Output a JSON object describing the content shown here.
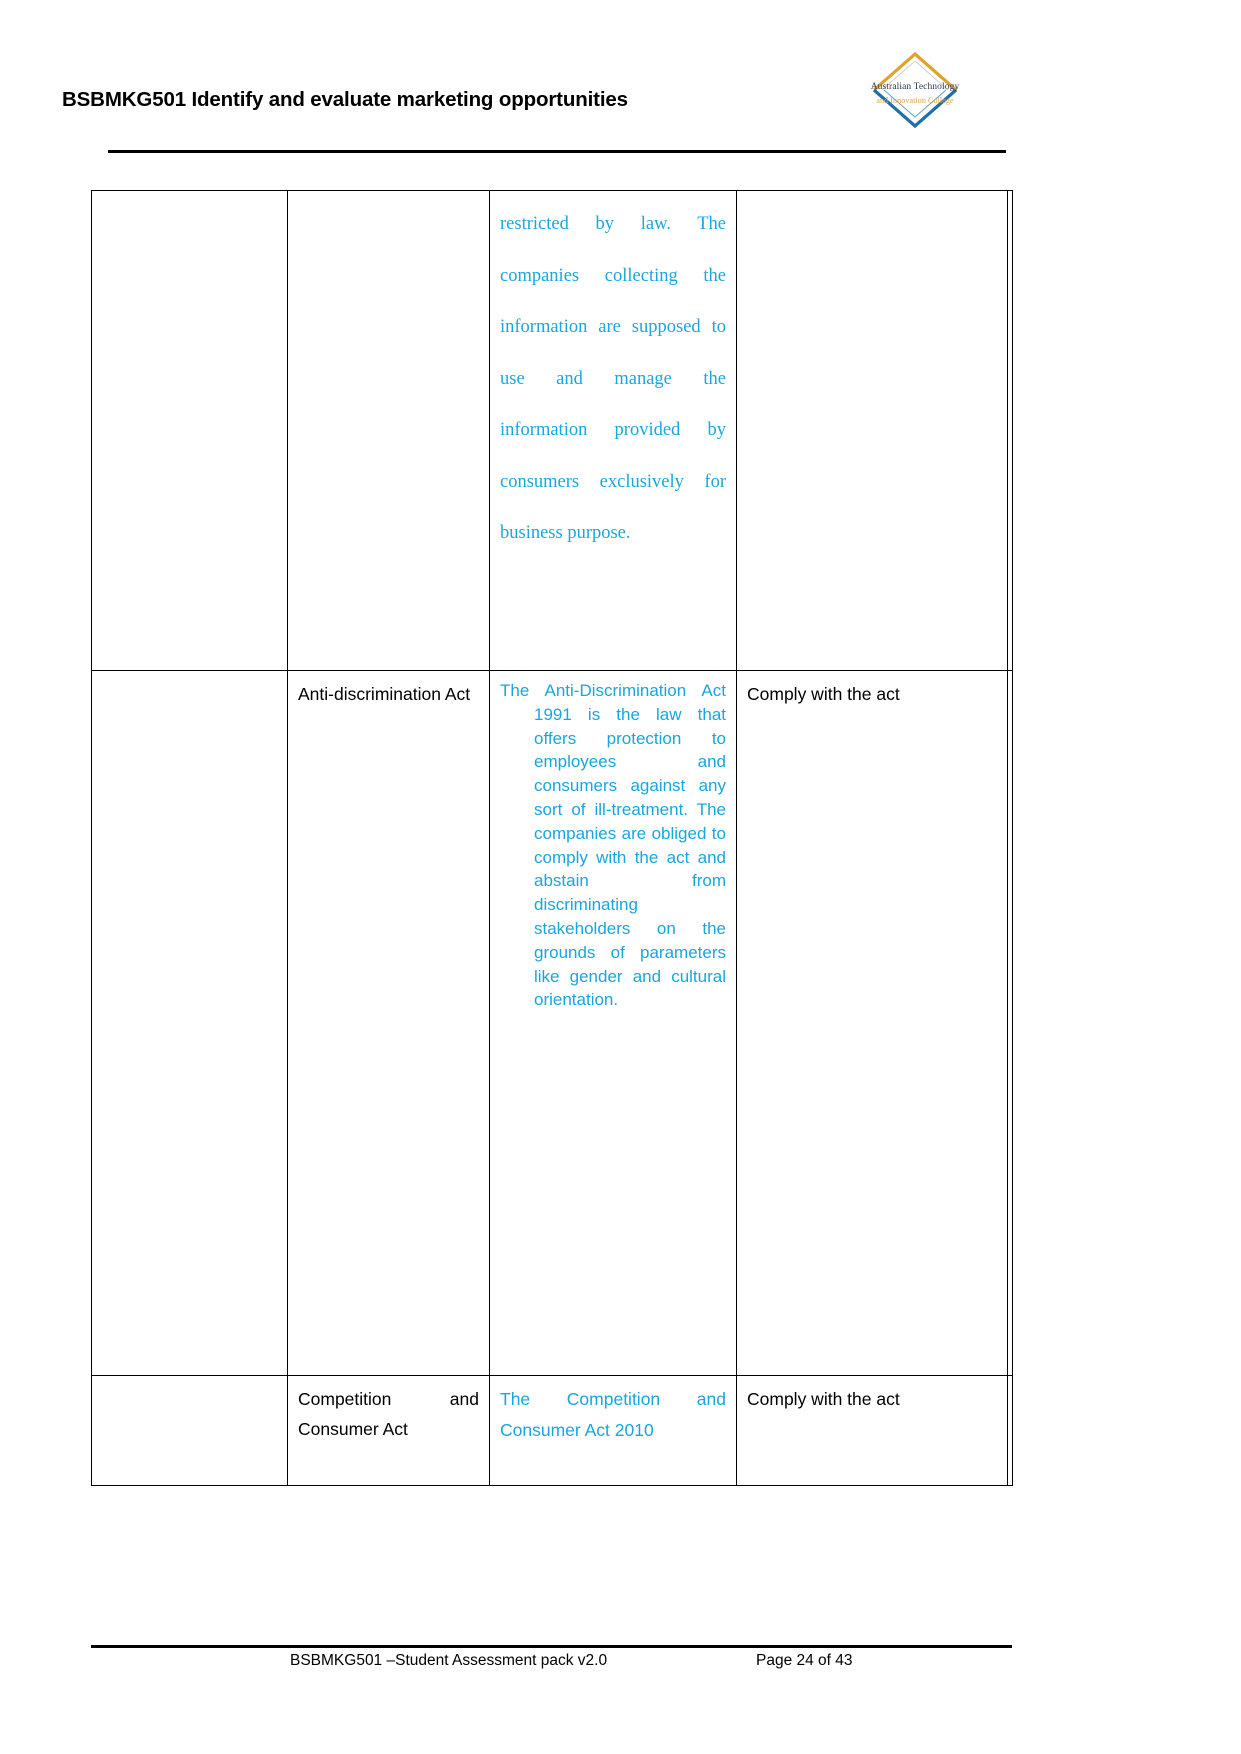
{
  "header": {
    "title": "BSBMKG501 Identify and evaluate marketing opportunities",
    "logo": {
      "name": "australian-technology-innovation-college-logo",
      "line1": "Australian Technology",
      "line2": "and Innovation College",
      "chevron_up_color": "#e0a32e",
      "chevron_down_color": "#1f6fa8"
    }
  },
  "colors": {
    "blue_text": "#19a6dd",
    "black_text": "#000000",
    "border": "#000000"
  },
  "table": {
    "rows": [
      {
        "name": "privacy-act-continued-row",
        "col_a": "",
        "col_b": "",
        "col_c": "restricted by law. The companies collecting the information are supposed to use and manage the information provided by consumers exclusively for business purpose.",
        "col_d": ""
      },
      {
        "name": "anti-discrimination-act-row",
        "col_a": "",
        "col_b": "Anti-discrimination Act",
        "col_c": "The Anti-Discrimination Act 1991 is the law that offers protection to employees and consumers against any sort of ill-treatment. The companies are obliged to comply with the act and abstain from discriminating stakeholders on the grounds of parameters like gender and cultural orientation",
        "col_c_terminator": ".",
        "col_d": "Comply with the act"
      },
      {
        "name": "competition-and-consumer-act-row",
        "col_a": "",
        "col_b": "Competition and Consumer Act",
        "col_c": "The Competition and Consumer Act 2010",
        "col_d": "Comply with the act"
      }
    ]
  },
  "footer": {
    "left": "BSBMKG501 –Student Assessment pack  v2.0",
    "right": "Page 24 of 43"
  }
}
